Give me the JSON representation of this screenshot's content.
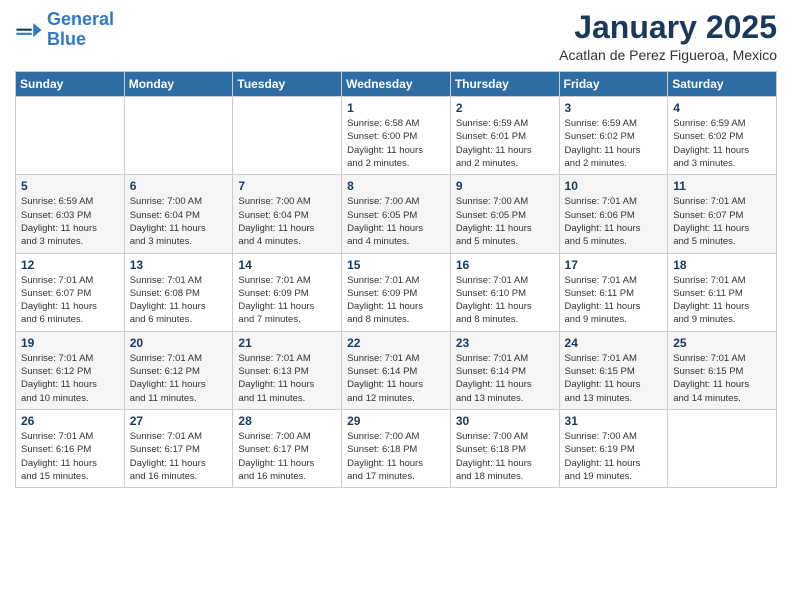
{
  "header": {
    "logo_line1": "General",
    "logo_line2": "Blue",
    "month_title": "January 2025",
    "location": "Acatlan de Perez Figueroa, Mexico"
  },
  "weekdays": [
    "Sunday",
    "Monday",
    "Tuesday",
    "Wednesday",
    "Thursday",
    "Friday",
    "Saturday"
  ],
  "weeks": [
    [
      {
        "day": "",
        "info": ""
      },
      {
        "day": "",
        "info": ""
      },
      {
        "day": "",
        "info": ""
      },
      {
        "day": "1",
        "info": "Sunrise: 6:58 AM\nSunset: 6:00 PM\nDaylight: 11 hours\nand 2 minutes."
      },
      {
        "day": "2",
        "info": "Sunrise: 6:59 AM\nSunset: 6:01 PM\nDaylight: 11 hours\nand 2 minutes."
      },
      {
        "day": "3",
        "info": "Sunrise: 6:59 AM\nSunset: 6:02 PM\nDaylight: 11 hours\nand 2 minutes."
      },
      {
        "day": "4",
        "info": "Sunrise: 6:59 AM\nSunset: 6:02 PM\nDaylight: 11 hours\nand 3 minutes."
      }
    ],
    [
      {
        "day": "5",
        "info": "Sunrise: 6:59 AM\nSunset: 6:03 PM\nDaylight: 11 hours\nand 3 minutes."
      },
      {
        "day": "6",
        "info": "Sunrise: 7:00 AM\nSunset: 6:04 PM\nDaylight: 11 hours\nand 3 minutes."
      },
      {
        "day": "7",
        "info": "Sunrise: 7:00 AM\nSunset: 6:04 PM\nDaylight: 11 hours\nand 4 minutes."
      },
      {
        "day": "8",
        "info": "Sunrise: 7:00 AM\nSunset: 6:05 PM\nDaylight: 11 hours\nand 4 minutes."
      },
      {
        "day": "9",
        "info": "Sunrise: 7:00 AM\nSunset: 6:05 PM\nDaylight: 11 hours\nand 5 minutes."
      },
      {
        "day": "10",
        "info": "Sunrise: 7:01 AM\nSunset: 6:06 PM\nDaylight: 11 hours\nand 5 minutes."
      },
      {
        "day": "11",
        "info": "Sunrise: 7:01 AM\nSunset: 6:07 PM\nDaylight: 11 hours\nand 5 minutes."
      }
    ],
    [
      {
        "day": "12",
        "info": "Sunrise: 7:01 AM\nSunset: 6:07 PM\nDaylight: 11 hours\nand 6 minutes."
      },
      {
        "day": "13",
        "info": "Sunrise: 7:01 AM\nSunset: 6:08 PM\nDaylight: 11 hours\nand 6 minutes."
      },
      {
        "day": "14",
        "info": "Sunrise: 7:01 AM\nSunset: 6:09 PM\nDaylight: 11 hours\nand 7 minutes."
      },
      {
        "day": "15",
        "info": "Sunrise: 7:01 AM\nSunset: 6:09 PM\nDaylight: 11 hours\nand 8 minutes."
      },
      {
        "day": "16",
        "info": "Sunrise: 7:01 AM\nSunset: 6:10 PM\nDaylight: 11 hours\nand 8 minutes."
      },
      {
        "day": "17",
        "info": "Sunrise: 7:01 AM\nSunset: 6:11 PM\nDaylight: 11 hours\nand 9 minutes."
      },
      {
        "day": "18",
        "info": "Sunrise: 7:01 AM\nSunset: 6:11 PM\nDaylight: 11 hours\nand 9 minutes."
      }
    ],
    [
      {
        "day": "19",
        "info": "Sunrise: 7:01 AM\nSunset: 6:12 PM\nDaylight: 11 hours\nand 10 minutes."
      },
      {
        "day": "20",
        "info": "Sunrise: 7:01 AM\nSunset: 6:12 PM\nDaylight: 11 hours\nand 11 minutes."
      },
      {
        "day": "21",
        "info": "Sunrise: 7:01 AM\nSunset: 6:13 PM\nDaylight: 11 hours\nand 11 minutes."
      },
      {
        "day": "22",
        "info": "Sunrise: 7:01 AM\nSunset: 6:14 PM\nDaylight: 11 hours\nand 12 minutes."
      },
      {
        "day": "23",
        "info": "Sunrise: 7:01 AM\nSunset: 6:14 PM\nDaylight: 11 hours\nand 13 minutes."
      },
      {
        "day": "24",
        "info": "Sunrise: 7:01 AM\nSunset: 6:15 PM\nDaylight: 11 hours\nand 13 minutes."
      },
      {
        "day": "25",
        "info": "Sunrise: 7:01 AM\nSunset: 6:15 PM\nDaylight: 11 hours\nand 14 minutes."
      }
    ],
    [
      {
        "day": "26",
        "info": "Sunrise: 7:01 AM\nSunset: 6:16 PM\nDaylight: 11 hours\nand 15 minutes."
      },
      {
        "day": "27",
        "info": "Sunrise: 7:01 AM\nSunset: 6:17 PM\nDaylight: 11 hours\nand 16 minutes."
      },
      {
        "day": "28",
        "info": "Sunrise: 7:00 AM\nSunset: 6:17 PM\nDaylight: 11 hours\nand 16 minutes."
      },
      {
        "day": "29",
        "info": "Sunrise: 7:00 AM\nSunset: 6:18 PM\nDaylight: 11 hours\nand 17 minutes."
      },
      {
        "day": "30",
        "info": "Sunrise: 7:00 AM\nSunset: 6:18 PM\nDaylight: 11 hours\nand 18 minutes."
      },
      {
        "day": "31",
        "info": "Sunrise: 7:00 AM\nSunset: 6:19 PM\nDaylight: 11 hours\nand 19 minutes."
      },
      {
        "day": "",
        "info": ""
      }
    ]
  ]
}
